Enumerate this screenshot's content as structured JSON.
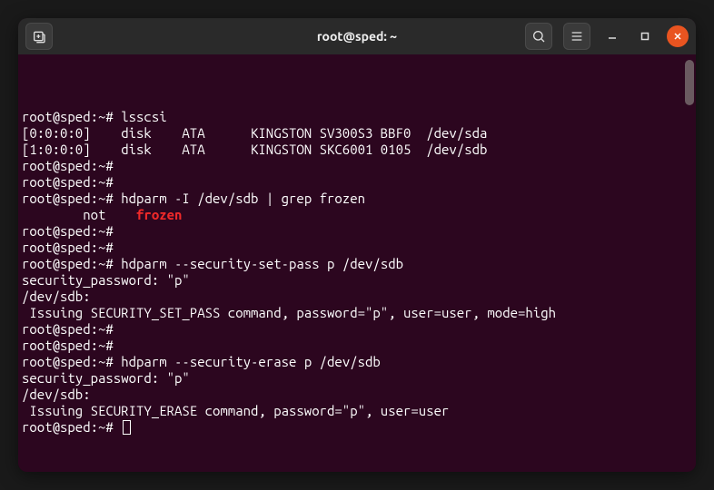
{
  "titlebar": {
    "title": "root@sped: ~"
  },
  "prompt": {
    "user": "root@sped",
    "sep": ":",
    "path": "~",
    "sym": "#"
  },
  "lines": [
    {
      "type": "cmd",
      "text": "lsscsi"
    },
    {
      "type": "out",
      "text": "[0:0:0:0]    disk    ATA      KINGSTON SV300S3 BBF0  /dev/sda"
    },
    {
      "type": "out",
      "text": "[1:0:0:0]    disk    ATA      KINGSTON SKC6001 0105  /dev/sdb"
    },
    {
      "type": "cmd",
      "text": ""
    },
    {
      "type": "cmd",
      "text": ""
    },
    {
      "type": "cmd",
      "text": "hdparm -I /dev/sdb | grep frozen"
    },
    {
      "type": "out_hl",
      "pre": "        not    ",
      "hl": "frozen"
    },
    {
      "type": "cmd",
      "text": ""
    },
    {
      "type": "cmd",
      "text": ""
    },
    {
      "type": "cmd",
      "text": "hdparm --security-set-pass p /dev/sdb"
    },
    {
      "type": "out",
      "text": "security_password: \"p\""
    },
    {
      "type": "out",
      "text": ""
    },
    {
      "type": "out",
      "text": "/dev/sdb:"
    },
    {
      "type": "out",
      "text": " Issuing SECURITY_SET_PASS command, password=\"p\", user=user, mode=high"
    },
    {
      "type": "cmd",
      "text": ""
    },
    {
      "type": "cmd",
      "text": ""
    },
    {
      "type": "cmd",
      "text": "hdparm --security-erase p /dev/sdb"
    },
    {
      "type": "out",
      "text": "security_password: \"p\""
    },
    {
      "type": "out",
      "text": ""
    },
    {
      "type": "out",
      "text": "/dev/sdb:"
    },
    {
      "type": "out",
      "text": " Issuing SECURITY_ERASE command, password=\"p\", user=user"
    },
    {
      "type": "cmd_cursor",
      "text": ""
    }
  ]
}
